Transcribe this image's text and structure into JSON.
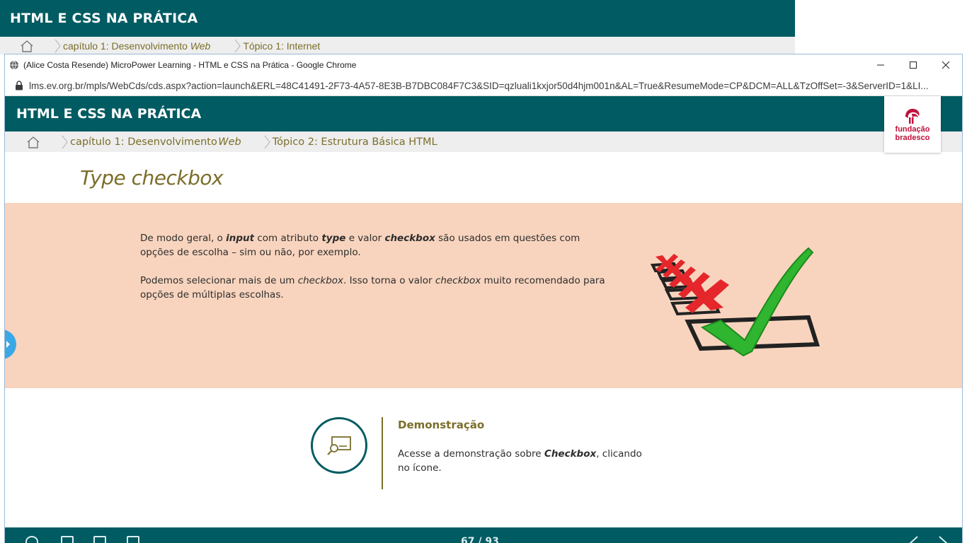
{
  "background_window": {
    "title": "HTML E CSS NA PRÁTICA",
    "breadcrumb": {
      "home_icon": "home-icon",
      "chapter_prefix": "capítulo 1: Desenvolvimento ",
      "chapter_emph": "Web",
      "topic": "Tópico 1: Internet"
    }
  },
  "chrome": {
    "window_title": "(Alice Costa Resende) MicroPower Learning - HTML e CSS na Prática - Google Chrome",
    "url": "lms.ev.org.br/mpls/WebCds/cds.aspx?action=launch&ERL=48C41491-2F73-4A57-8E3B-B7DBC084F7C3&SID=qzluali1kxjor50d4hjm001n&AL=True&ResumeMode=CP&DCM=ALL&TzOffSet=-3&ServerID=1&LI...",
    "controls": [
      "minimize-icon",
      "maximize-icon",
      "close-icon"
    ]
  },
  "app": {
    "header_title": "HTML E CSS NA PRÁTICA",
    "logo": {
      "line1": "fundação",
      "line2": "bradesco",
      "brand_color": "#c0123c"
    },
    "breadcrumb": {
      "chapter_prefix": "capítulo 1: Desenvolvimento ",
      "chapter_emph": "Web",
      "topic": "Tópico 2: Estrutura Básica HTML"
    },
    "page_title": "Type checkbox",
    "intro": {
      "p1_a": "De modo geral, o ",
      "p1_b": "input",
      "p1_c": " com atributo ",
      "p1_d": "type",
      "p1_e": " e valor ",
      "p1_f": "checkbox",
      "p1_g": " são usados em questões com opções de escolha – sim ou não, por exemplo.",
      "p2_a": "Podemos selecionar mais de um ",
      "p2_b": "checkbox",
      "p2_c": ". Isso torna o valor ",
      "p2_d": "checkbox",
      "p2_e": " muito recomendado para opções de múltiplas escolhas."
    },
    "demo": {
      "title": "Demonstração",
      "text_a": "Acesse a demonstração sobre ",
      "text_b": "Checkbox",
      "text_c": ", clicando no ícone."
    },
    "footer": {
      "page_counter": "67 / 93"
    },
    "colors": {
      "teal": "#005b62",
      "olive": "#7a6e2a",
      "peach": "#f8d4be",
      "tab_blue": "#3aa8e6"
    }
  }
}
